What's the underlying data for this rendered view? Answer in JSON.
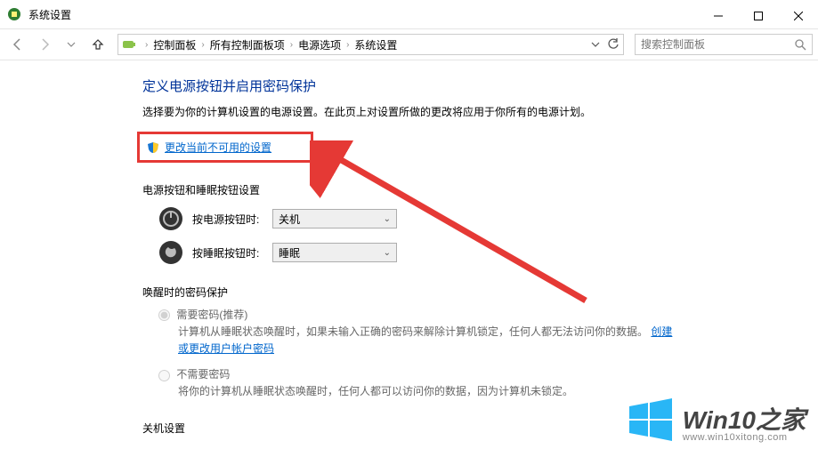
{
  "window": {
    "title": "系统设置"
  },
  "breadcrumbs": {
    "items": [
      "控制面板",
      "所有控制面板项",
      "电源选项",
      "系统设置"
    ]
  },
  "search": {
    "placeholder": "搜索控制面板"
  },
  "page": {
    "title": "定义电源按钮并启用密码保护",
    "desc": "选择要为你的计算机设置的电源设置。在此页上对设置所做的更改将应用于你所有的电源计划。",
    "change_link": "更改当前不可用的设置"
  },
  "buttons_section": {
    "title": "电源按钮和睡眠按钮设置",
    "power_label": "按电源按钮时:",
    "power_value": "关机",
    "sleep_label": "按睡眠按钮时:",
    "sleep_value": "睡眠"
  },
  "password_section": {
    "title": "唤醒时的密码保护",
    "require_label": "需要密码(推荐)",
    "require_desc_pre": "计算机从睡眠状态唤醒时，如果未输入正确的密码来解除计算机锁定，任何人都无法访问你的数据。",
    "require_link": "创建或更改用户帐户密码",
    "norequire_label": "不需要密码",
    "norequire_desc": "将你的计算机从睡眠状态唤醒时，任何人都可以访问你的数据，因为计算机未锁定。"
  },
  "shutdown_section": {
    "title": "关机设置"
  },
  "watermark": {
    "main": "Win10之家",
    "sub": "www.win10xitong.com"
  }
}
